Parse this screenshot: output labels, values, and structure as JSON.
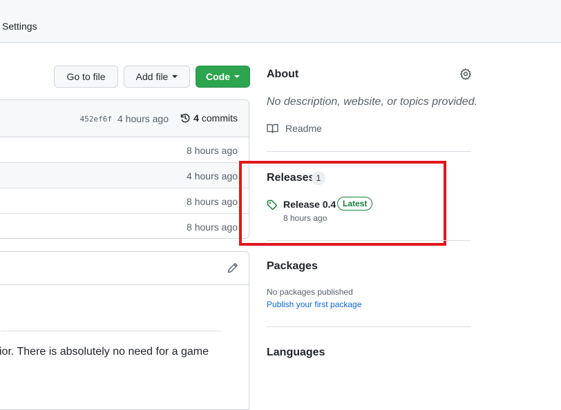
{
  "nav": {
    "settings_label": "Settings"
  },
  "actions": {
    "go_to_file": "Go to file",
    "add_file": "Add file",
    "code": "Code"
  },
  "latest_commit": {
    "hash": "452ef6f",
    "time": "4 hours ago",
    "commit_count": "4",
    "commits_label": "commits"
  },
  "files": [
    {
      "time": "8 hours ago"
    },
    {
      "time": "4 hours ago"
    },
    {
      "time": "8 hours ago"
    },
    {
      "time": "8 hours ago"
    }
  ],
  "readme": {
    "text_fragment": "vior. There is absolutely no need for a game"
  },
  "about": {
    "title": "About",
    "description": "No description, website, or topics provided.",
    "readme_label": "Readme"
  },
  "releases": {
    "title": "Releases",
    "count": "1",
    "latest": {
      "name": "Release 0.4",
      "badge": "Latest",
      "time": "8 hours ago"
    }
  },
  "packages": {
    "title": "Packages",
    "empty_text": "No packages published",
    "publish_link": "Publish your first package"
  },
  "languages": {
    "title": "Languages"
  },
  "colors": {
    "primary_button": "#2da44e",
    "latest_badge": "#1a7f37",
    "annotation_box": "#e0171f",
    "link": "#0969da"
  }
}
